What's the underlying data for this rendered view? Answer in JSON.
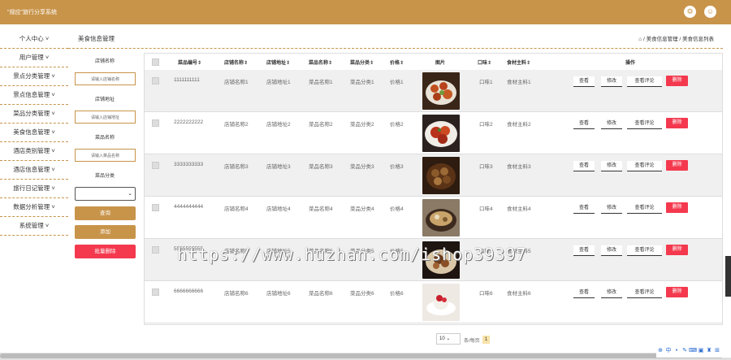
{
  "app": {
    "title": "\"规应\"旅行分享系统"
  },
  "top_icons": {
    "settings": "⚙",
    "user": "☺"
  },
  "sidebar": {
    "items": [
      {
        "label": "个人中心 ˅"
      },
      {
        "label": "用户管理 ˅"
      },
      {
        "label": "景点分类管理 ˅"
      },
      {
        "label": "景点信息管理 ˅"
      },
      {
        "label": "菜品分类管理 ˅"
      },
      {
        "label": "美食信息管理 ˅"
      },
      {
        "label": "酒店类别管理 ˅"
      },
      {
        "label": "酒店信息管理 ˅"
      },
      {
        "label": "旅行日记管理 ˅"
      },
      {
        "label": "数据分析管理 ˅"
      },
      {
        "label": "系统管理 ˅"
      }
    ]
  },
  "page": {
    "title": "美食信息管理",
    "breadcrumb": "⌂ / 美食信息管理 / 美食信息列表"
  },
  "search": {
    "shop_name_label": "店铺名称",
    "shop_name_placeholder": "请输入店铺名称",
    "shop_addr_label": "店铺地址",
    "shop_addr_placeholder": "请输入店铺地址",
    "dish_name_label": "菜品名称",
    "dish_name_placeholder": "请输入菜品名称",
    "dish_cat_label": "菜品分类",
    "dish_cat_value": "",
    "query_btn": "查询",
    "add_btn": "添加",
    "batch_delete_btn": "批量删除"
  },
  "table": {
    "headers": [
      "菜品编号⇕",
      "店铺名称⇕",
      "店铺地址⇕",
      "菜品名称⇕",
      "菜品分类⇕",
      "价格⇕",
      "图片",
      "口味⇕",
      "食材主料⇕",
      "操作"
    ],
    "rows": [
      {
        "id": "1111111111",
        "shop": "店铺名称1",
        "addr": "店铺地址1",
        "name": "菜品名称1",
        "cat": "菜品分类1",
        "price": "价格1",
        "taste": "口味1",
        "ingredient": "食材主料1"
      },
      {
        "id": "2222222222",
        "shop": "店铺名称2",
        "addr": "店铺地址2",
        "name": "菜品名称2",
        "cat": "菜品分类2",
        "price": "价格2",
        "taste": "口味2",
        "ingredient": "食材主料2"
      },
      {
        "id": "3333333333",
        "shop": "店铺名称3",
        "addr": "店铺地址3",
        "name": "菜品名称3",
        "cat": "菜品分类3",
        "price": "价格3",
        "taste": "口味3",
        "ingredient": "食材主料3"
      },
      {
        "id": "4444444444",
        "shop": "店铺名称4",
        "addr": "店铺地址4",
        "name": "菜品名称4",
        "cat": "菜品分类4",
        "price": "价格4",
        "taste": "口味4",
        "ingredient": "食材主料4"
      },
      {
        "id": "5555555555",
        "shop": "店铺名称5",
        "addr": "店铺地址5",
        "name": "菜品名称5",
        "cat": "菜品分类5",
        "price": "价格5",
        "taste": "口味5",
        "ingredient": "食材主料5"
      },
      {
        "id": "6666666666",
        "shop": "店铺名称6",
        "addr": "店铺地址6",
        "name": "菜品名称6",
        "cat": "菜品分类6",
        "price": "价格6",
        "taste": "口味6",
        "ingredient": "食材主料6"
      }
    ],
    "actions": {
      "view": "查看",
      "edit": "修改",
      "comments": "查看评论",
      "delete": "删除"
    }
  },
  "pager": {
    "page_size": "10",
    "per_page_label": "条/每页",
    "current": "1"
  },
  "watermark": "https://www.huzhan.com/ishop39397",
  "colors": {
    "brand": "#c8944a",
    "danger": "#f4394e"
  }
}
